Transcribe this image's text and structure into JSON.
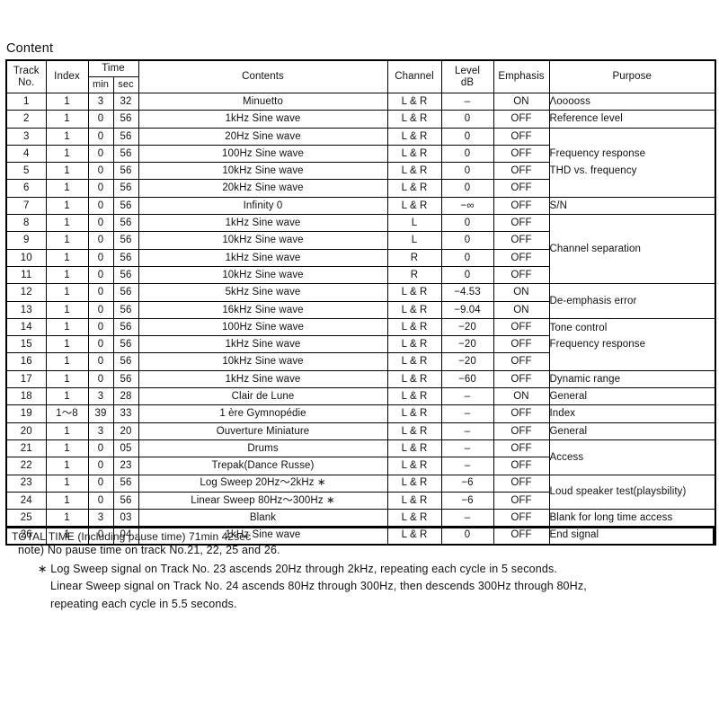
{
  "page_title": "Content",
  "table": {
    "headers": {
      "track_no": "Track\nNo.",
      "track_no_line1": "Track",
      "track_no_line2": "No.",
      "index": "Index",
      "time": "Time",
      "min": "min",
      "sec": "sec",
      "contents": "Contents",
      "channel": "Channel",
      "level_line1": "Level",
      "level_line2": "dB",
      "emphasis": "Emphasis",
      "purpose": "Purpose"
    },
    "rows": [
      {
        "track": "1",
        "index": "1",
        "min": "3",
        "sec": "32",
        "contents": "Minuetto",
        "channel": "L & R",
        "level": "–",
        "emphasis": "ON",
        "purpose": "Λooooss"
      },
      {
        "track": "2",
        "index": "1",
        "min": "0",
        "sec": "56",
        "contents": "1kHz Sine wave",
        "channel": "L & R",
        "level": "0",
        "emphasis": "OFF",
        "purpose": "Reference level"
      },
      {
        "track": "3",
        "index": "1",
        "min": "0",
        "sec": "56",
        "contents": "20Hz Sine wave",
        "channel": "L & R",
        "level": "0",
        "emphasis": "OFF",
        "purpose": ""
      },
      {
        "track": "4",
        "index": "1",
        "min": "0",
        "sec": "56",
        "contents": "100Hz Sine wave",
        "channel": "L & R",
        "level": "0",
        "emphasis": "OFF",
        "purpose": "Frequency response"
      },
      {
        "track": "5",
        "index": "1",
        "min": "0",
        "sec": "56",
        "contents": "10kHz Sine wave",
        "channel": "L & R",
        "level": "0",
        "emphasis": "OFF",
        "purpose": "THD vs. frequency"
      },
      {
        "track": "6",
        "index": "1",
        "min": "0",
        "sec": "56",
        "contents": "20kHz Sine wave",
        "channel": "L & R",
        "level": "0",
        "emphasis": "OFF",
        "purpose": ""
      },
      {
        "track": "7",
        "index": "1",
        "min": "0",
        "sec": "56",
        "contents": "Infinity 0",
        "channel": "L & R",
        "level": "−∞",
        "emphasis": "OFF",
        "purpose": "S/N"
      },
      {
        "track": "8",
        "index": "1",
        "min": "0",
        "sec": "56",
        "contents": "1kHz Sine wave",
        "channel": "L",
        "level": "0",
        "emphasis": "OFF",
        "purpose": ""
      },
      {
        "track": "9",
        "index": "1",
        "min": "0",
        "sec": "56",
        "contents": "10kHz Sine wave",
        "channel": "L",
        "level": "0",
        "emphasis": "OFF",
        "purpose": "Channel separation"
      },
      {
        "track": "10",
        "index": "1",
        "min": "0",
        "sec": "56",
        "contents": "1kHz Sine wave",
        "channel": "R",
        "level": "0",
        "emphasis": "OFF",
        "purpose": ""
      },
      {
        "track": "11",
        "index": "1",
        "min": "0",
        "sec": "56",
        "contents": "10kHz Sine wave",
        "channel": "R",
        "level": "0",
        "emphasis": "OFF",
        "purpose": ""
      },
      {
        "track": "12",
        "index": "1",
        "min": "0",
        "sec": "56",
        "contents": "5kHz Sine wave",
        "channel": "L & R",
        "level": "−4.53",
        "emphasis": "ON",
        "purpose": "De-emphasis error"
      },
      {
        "track": "13",
        "index": "1",
        "min": "0",
        "sec": "56",
        "contents": "16kHz Sine wave",
        "channel": "L & R",
        "level": "−9.04",
        "emphasis": "ON",
        "purpose": ""
      },
      {
        "track": "14",
        "index": "1",
        "min": "0",
        "sec": "56",
        "contents": "100Hz Sine wave",
        "channel": "L & R",
        "level": "−20",
        "emphasis": "OFF",
        "purpose": "Tone control"
      },
      {
        "track": "15",
        "index": "1",
        "min": "0",
        "sec": "56",
        "contents": "1kHz Sine wave",
        "channel": "L & R",
        "level": "−20",
        "emphasis": "OFF",
        "purpose": "Frequency response"
      },
      {
        "track": "16",
        "index": "1",
        "min": "0",
        "sec": "56",
        "contents": "10kHz Sine wave",
        "channel": "L & R",
        "level": "−20",
        "emphasis": "OFF",
        "purpose": ""
      },
      {
        "track": "17",
        "index": "1",
        "min": "0",
        "sec": "56",
        "contents": "1kHz Sine wave",
        "channel": "L & R",
        "level": "−60",
        "emphasis": "OFF",
        "purpose": "Dynamic range"
      },
      {
        "track": "18",
        "index": "1",
        "min": "3",
        "sec": "28",
        "contents": "Clair de Lune",
        "channel": "L & R",
        "level": "–",
        "emphasis": "ON",
        "purpose": "General"
      },
      {
        "track": "19",
        "index": "1〜8",
        "min": "39",
        "sec": "33",
        "contents": "1 ère Gymnopédie",
        "channel": "L & R",
        "level": "–",
        "emphasis": "OFF",
        "purpose": "Index"
      },
      {
        "track": "20",
        "index": "1",
        "min": "3",
        "sec": "20",
        "contents": "Ouverture Miniature",
        "channel": "L & R",
        "level": "–",
        "emphasis": "OFF",
        "purpose": "General"
      },
      {
        "track": "21",
        "index": "1",
        "min": "0",
        "sec": "05",
        "contents": "Drums",
        "channel": "L & R",
        "level": "–",
        "emphasis": "OFF",
        "purpose": "Access"
      },
      {
        "track": "22",
        "index": "1",
        "min": "0",
        "sec": "23",
        "contents": "Trepak(Dance Russe)",
        "channel": "L & R",
        "level": "–",
        "emphasis": "OFF",
        "purpose": ""
      },
      {
        "track": "23",
        "index": "1",
        "min": "0",
        "sec": "56",
        "contents": "Log Sweep 20Hz〜2kHz  ∗",
        "channel": "L & R",
        "level": "−6",
        "emphasis": "OFF",
        "purpose": "Loud speaker test(playsbility)"
      },
      {
        "track": "24",
        "index": "1",
        "min": "0",
        "sec": "56",
        "contents": "Linear Sweep 80Hz〜300Hz  ∗",
        "channel": "L & R",
        "level": "−6",
        "emphasis": "OFF",
        "purpose": ""
      },
      {
        "track": "25",
        "index": "1",
        "min": "3",
        "sec": "03",
        "contents": "Blank",
        "channel": "L & R",
        "level": "–",
        "emphasis": "OFF",
        "purpose": "Blank for long time access"
      },
      {
        "track": "26",
        "index": "1",
        "min": "0",
        "sec": "04",
        "contents": "1kHz Sine wave",
        "channel": "L & R",
        "level": "0",
        "emphasis": "OFF",
        "purpose": "End signal"
      }
    ],
    "total_time": "TOTAL TIME (Including pause time) 71min 42sec"
  },
  "notes": {
    "note_main": "note) No pause time on track No.21, 22, 25 and 26.",
    "star_symbol": "∗",
    "star_line1": "Log Sweep signal on Track No. 23 ascends 20Hz through 2kHz, repeating each cycle in 5 seconds.",
    "star_line2": "Linear Sweep signal on Track No. 24 ascends 80Hz through 300Hz, then descends  300Hz through 80Hz,",
    "star_line3": "repeating each cycle in 5.5 seconds."
  }
}
